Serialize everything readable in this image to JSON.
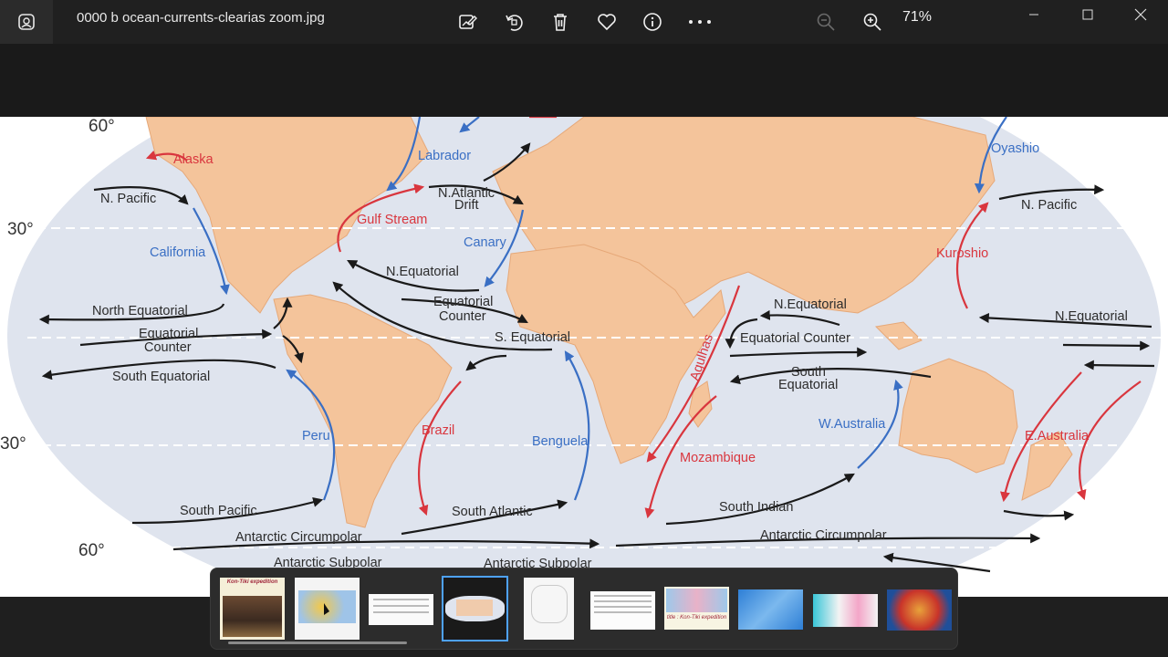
{
  "window": {
    "filename": "0000 b ocean-currents-clearias zoom.jpg",
    "zoom_level": "71%"
  },
  "toolbar_icons": [
    "edit-image-icon",
    "rotate-icon",
    "delete-icon",
    "favorite-icon",
    "info-icon",
    "more-icon",
    "zoom-out-icon",
    "zoom-in-icon"
  ],
  "map": {
    "lat_labels": {
      "top60": "60°",
      "top30": "30°",
      "bottom30": "30°",
      "bottom60": "60°"
    },
    "currents": {
      "alaska": "Alaska",
      "n_pacific_w": "N. Pacific",
      "labrador": "Labrador",
      "n_atlantic_drift_1": "N.Atlantic",
      "n_atlantic_drift_2": "Drift",
      "gulf_stream": "Gulf Stream",
      "california": "California",
      "canary": "Canary",
      "n_equatorial_atl": "N.Equatorial",
      "north_equatorial_pac": "North Equatorial",
      "eq_counter_atl_1": "Equatorial",
      "eq_counter_atl_2": "Counter",
      "eq_counter_pac_1": "Equatorial",
      "eq_counter_pac_2": "Counter",
      "s_equatorial_atl": "S. Equatorial",
      "south_equatorial_pac": "South Equatorial",
      "peru": "Peru",
      "brazil": "Brazil",
      "benguela": "Benguela",
      "south_pacific": "South Pacific",
      "south_atlantic": "South Atlantic",
      "antarctic_circumpolar_w": "Antarctic Circumpolar",
      "antarctic_subpolar_w": "Antarctic Subpolar",
      "antarctic_subpolar_c": "Antarctic Subpolar",
      "oyashio": "Oyashio",
      "n_pacific_e": "N. Pacific",
      "kuroshio": "Kuroshio",
      "n_equatorial_ind": "N.Equatorial",
      "equatorial_counter_ind": "Equatorial Counter",
      "south_equatorial_ind_1": "South",
      "south_equatorial_ind_2": "Equatorial",
      "n_equatorial_e": "N.Equatorial",
      "agulhas": "Agulhas",
      "mozambique": "Mozambique",
      "w_australia": "W.Australia",
      "e_australia": "E.Australia",
      "south_indian": "South Indian",
      "antarctic_circumpolar_e": "Antarctic Circumpolar"
    }
  },
  "filmstrip": {
    "thumb1_title": "Kon-Tiki expedition",
    "thumb8_title": "title : Kon-Tiki expedition",
    "selected_index": 4
  },
  "colors": {
    "warm": "#d9363e",
    "cold": "#3a6fc4",
    "land": "#f4c49b",
    "ocean": "#dfe4ee",
    "selection": "#4ea2ff"
  }
}
